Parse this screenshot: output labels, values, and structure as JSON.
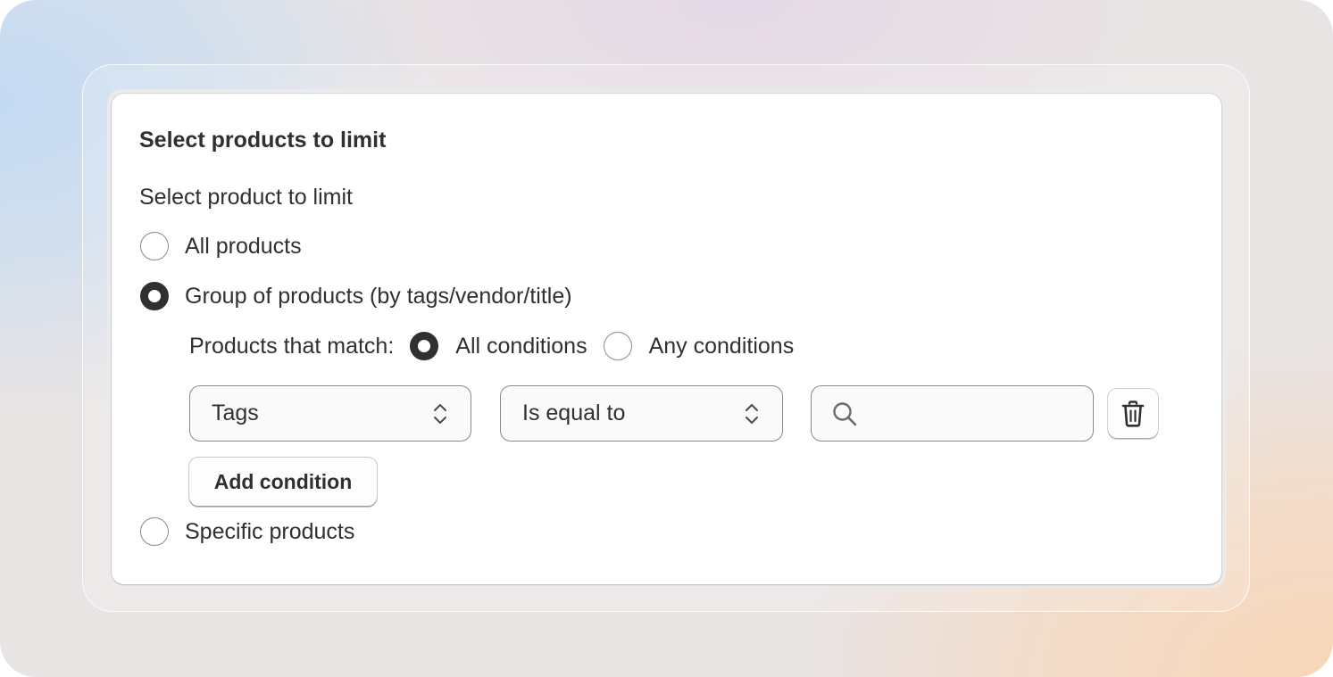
{
  "card": {
    "title": "Select products to limit",
    "section_label": "Select product to limit"
  },
  "product_scope": {
    "selected": "group",
    "options": {
      "all": "All products",
      "group": "Group of products (by tags/vendor/title)",
      "specific": "Specific products"
    }
  },
  "match": {
    "label": "Products that match:",
    "selected": "all",
    "all_label": "All conditions",
    "any_label": "Any conditions"
  },
  "condition": {
    "field": "Tags",
    "operator": "Is equal to",
    "value": "",
    "value_placeholder": ""
  },
  "buttons": {
    "add_condition": "Add condition"
  },
  "icons": {
    "field_chevron": "chevron-up-down-icon",
    "operator_chevron": "chevron-up-down-icon",
    "search": "search-icon",
    "delete": "trash-icon"
  },
  "colors": {
    "text": "#303030",
    "border": "#8a8a8a",
    "card_bg": "#ffffff"
  }
}
